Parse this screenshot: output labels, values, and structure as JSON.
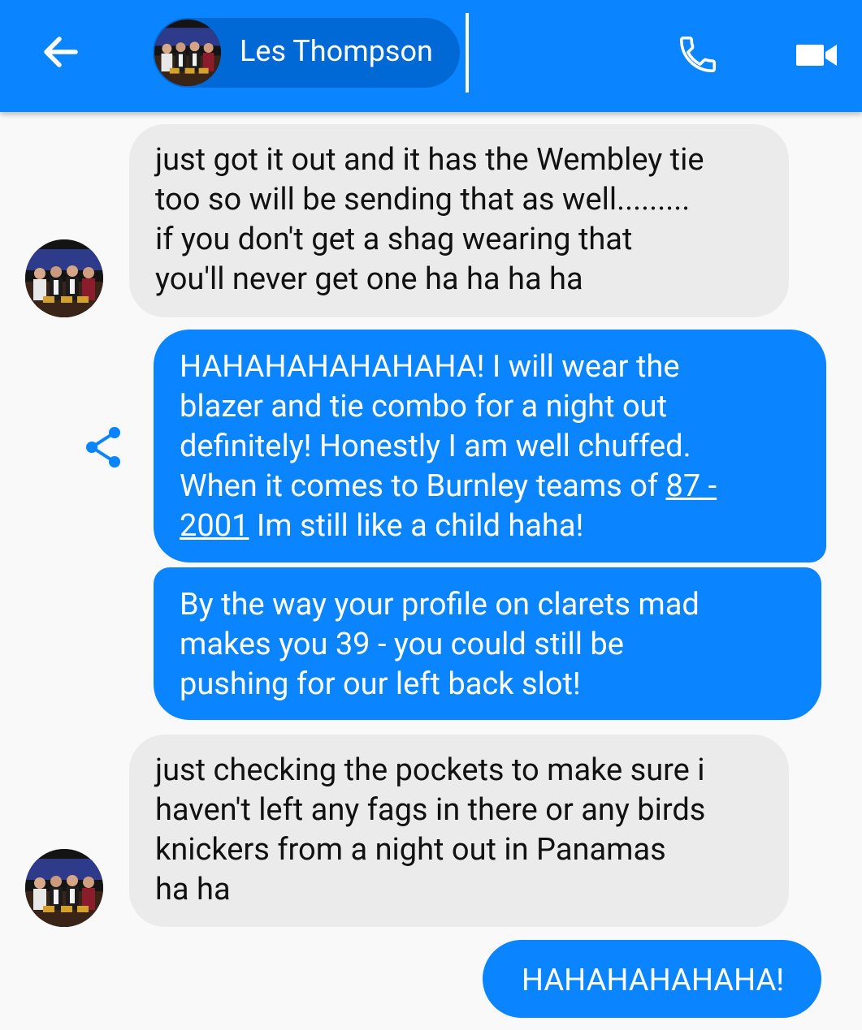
{
  "header": {
    "back_icon": "arrow-left-icon",
    "contact_name": "Les Thompson",
    "call_icon": "phone-icon",
    "video_icon": "video-camera-icon",
    "background_color": "#0a84ff"
  },
  "messages": [
    {
      "direction": "incoming",
      "text": "just got it out and it has the Wembley tie\ntoo so will be sending that as well.........\nif you don't get a shag wearing that\nyou'll never get one ha ha ha ha"
    },
    {
      "direction": "outgoing",
      "text_before_link": "HAHAHAHAHAHAHA! I will wear the\nblazer and tie combo for a night out\ndefinitely! Honestly I am well chuffed.\nWhen it comes to Burnley teams of ",
      "link_part1": "87 -",
      "link_part2": "2001",
      "text_after_link": " Im still like a child haha!"
    },
    {
      "direction": "outgoing",
      "text": "By the way your profile on clarets mad\nmakes you 39 - you could still be\npushing for our left back slot!"
    },
    {
      "direction": "incoming",
      "text": "just checking the pockets to make sure i\nhaven't left any fags in there or any birds\nknickers from a night out in Panamas\nha ha"
    },
    {
      "direction": "outgoing",
      "text": "HAHAHAHAHAHA!"
    }
  ],
  "share_icon": "share-icon",
  "colors": {
    "incoming_bubble": "#ebebeb",
    "outgoing_bubble": "#0a84ff",
    "chat_background": "#f9f9f9"
  }
}
